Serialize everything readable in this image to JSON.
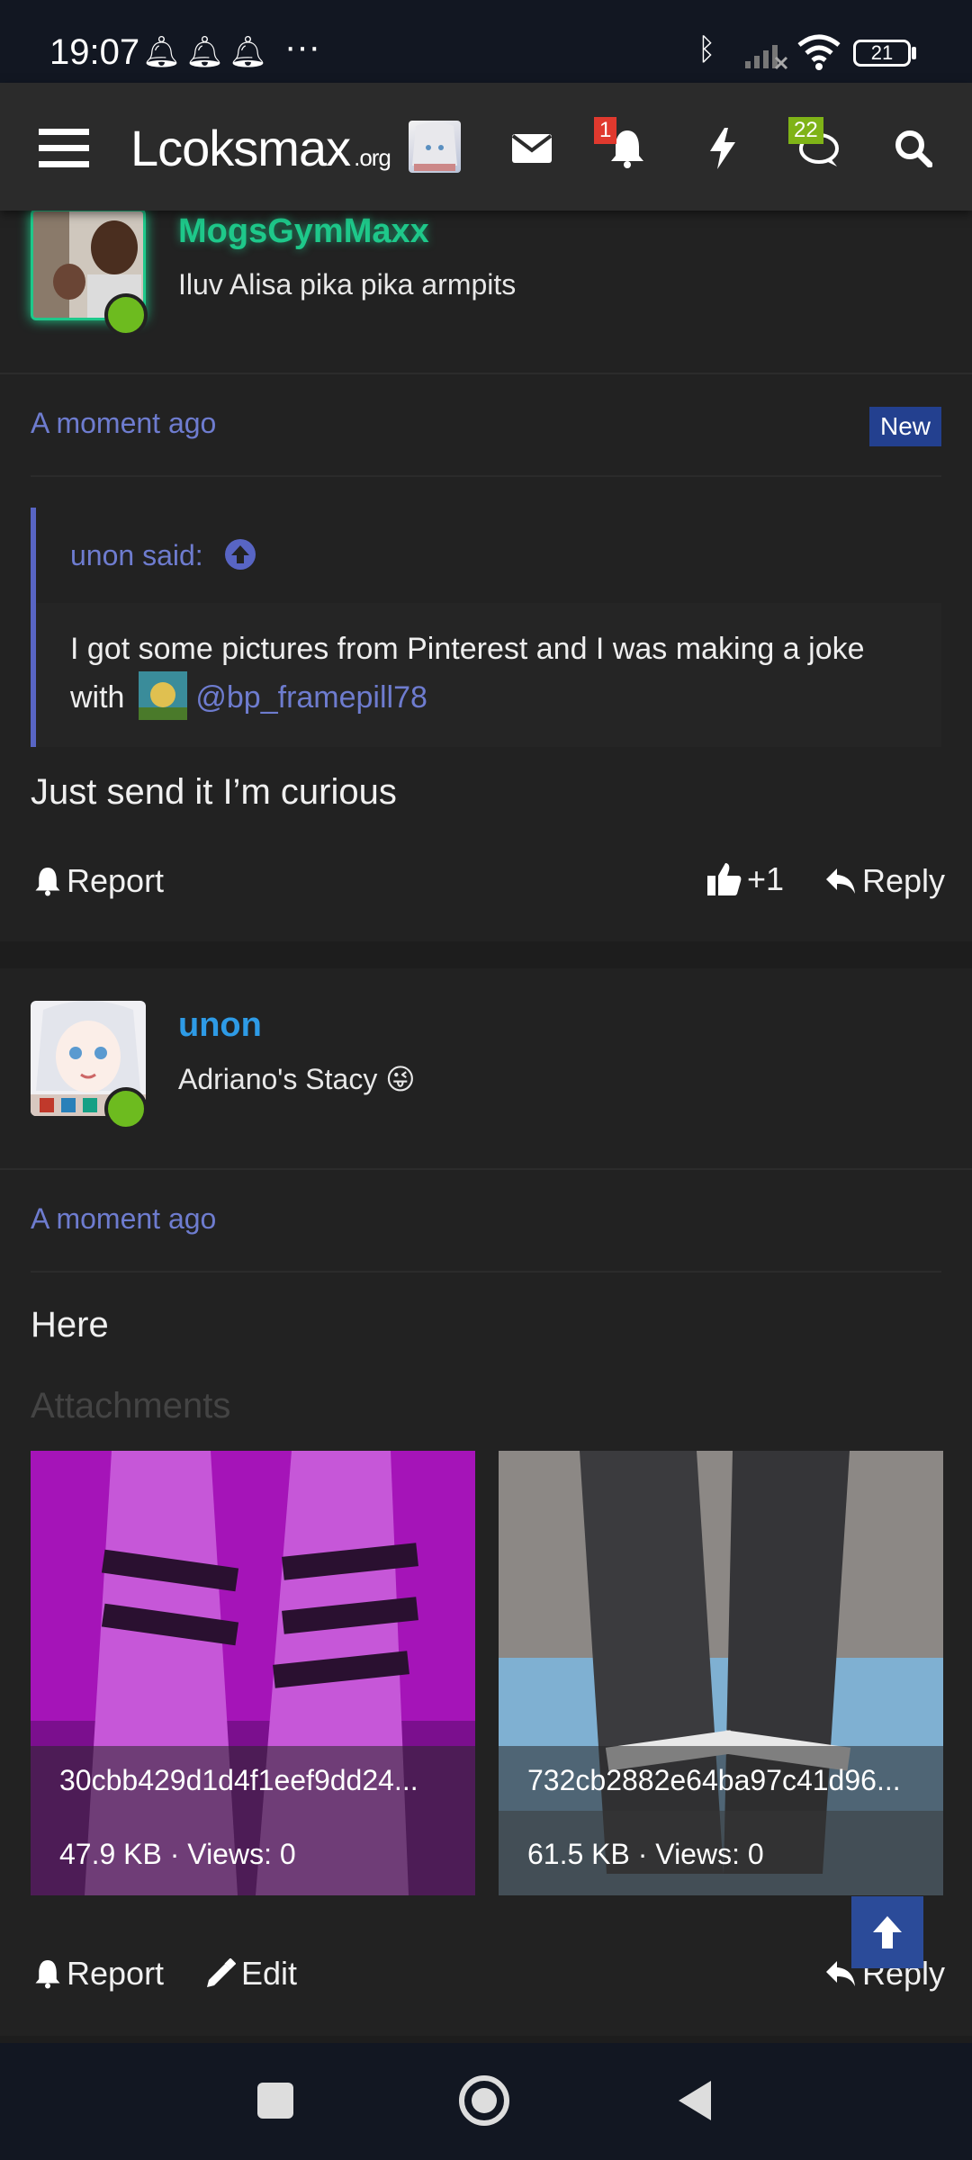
{
  "status": {
    "time": "19:07",
    "battery": "21"
  },
  "header": {
    "logo_text": "Lcoksmax",
    "logo_suffix": ".org",
    "alerts_badge": "1",
    "conversations_badge": "22"
  },
  "posts": [
    {
      "username": "MogsGymMaxx",
      "user_title": "Iluv Alisa pika pika armpits",
      "time": "A moment ago",
      "new_label": "New",
      "quote": {
        "author": "unon said:",
        "text": "I got some pictures from Pinterest and I was making a joke with",
        "mention": "@bp_framepill78"
      },
      "body": "Just send it I’m curious",
      "actions": {
        "report": "Report",
        "like_count": "+1",
        "reply": "Reply"
      }
    },
    {
      "username": "unon",
      "user_title": "Adriano's Stacy 😜",
      "time": "A moment ago",
      "body": "Here",
      "attachments_heading": "Attachments",
      "attachments": [
        {
          "name": "30cbb429d1d4f1eef9dd24...",
          "meta": "47.9 KB · Views: 0"
        },
        {
          "name": "732cb2882e64ba97c41d96...",
          "meta": "61.5 KB · Views: 0"
        }
      ],
      "actions": {
        "report": "Report",
        "edit": "Edit",
        "reply": "Reply"
      }
    }
  ],
  "colors": {
    "accent": "#6e7ccf",
    "username_green": "#1ec88a",
    "username_blue": "#2e9be6",
    "online": "#6dbb1f"
  }
}
